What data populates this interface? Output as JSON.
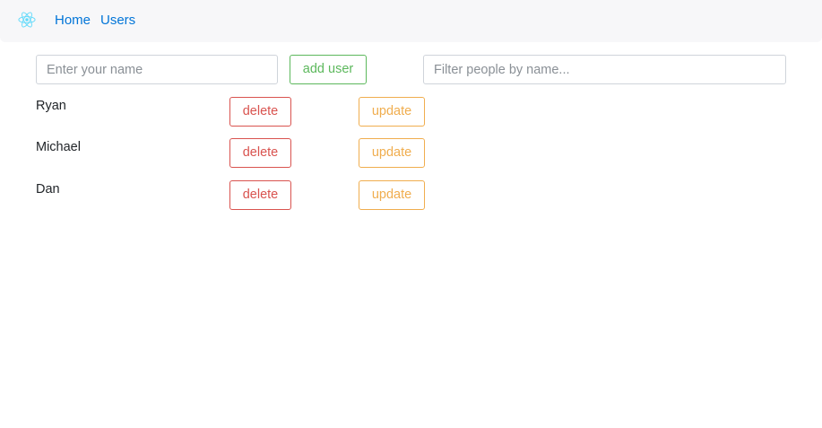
{
  "nav": {
    "logo_icon": "react-atom-icon",
    "logo_color": "#61dafb",
    "links": [
      {
        "label": "Home"
      },
      {
        "label": "Users"
      }
    ]
  },
  "form": {
    "name_placeholder": "Enter your name",
    "name_value": "",
    "add_button_label": "add user",
    "filter_placeholder": "Filter people by name...",
    "filter_value": ""
  },
  "users": [
    {
      "name": "Ryan",
      "delete_label": "delete",
      "update_label": "update"
    },
    {
      "name": "Michael",
      "delete_label": "delete",
      "update_label": "update"
    },
    {
      "name": "Dan",
      "delete_label": "delete",
      "update_label": "update"
    }
  ],
  "colors": {
    "link": "#0275d8",
    "success": "#5cb85c",
    "danger": "#d9534f",
    "warning": "#f0ad4e"
  }
}
